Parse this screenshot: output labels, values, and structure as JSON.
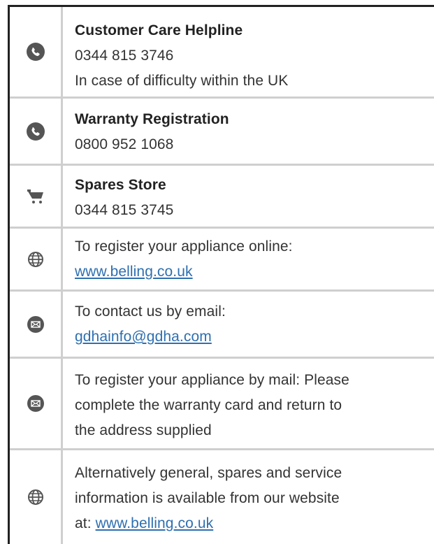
{
  "entries": [
    {
      "icon": "phone-icon",
      "title": "Customer Care Helpline",
      "line1": "0344 815 3746",
      "line2": "In case of difficulty within the UK"
    },
    {
      "icon": "phone-icon",
      "title": "Warranty Registration",
      "line1": "0800 952 1068"
    },
    {
      "icon": "cart-icon",
      "title": "Spares Store",
      "line1": "0344 815 3745"
    },
    {
      "icon": "globe-icon",
      "text": "To register your appliance online:",
      "link": "www.belling.co.uk"
    },
    {
      "icon": "mail-icon",
      "text": "To contact us by email:",
      "link": "gdhainfo@gdha.com"
    },
    {
      "icon": "mail-icon",
      "line1": "To register your appliance by mail: Please",
      "line2": "complete the warranty card and return to",
      "line3": "the address supplied"
    },
    {
      "icon": "globe-icon",
      "line1": "Alternatively general, spares and service",
      "line2": "information is available from our website",
      "prefix": "at: ",
      "link": "www.belling.co.uk"
    }
  ],
  "colors": {
    "text": "#333333",
    "link": "#2e6fb0",
    "icon": "#555555",
    "divider": "#cfcfcf",
    "frame": "#222222"
  }
}
